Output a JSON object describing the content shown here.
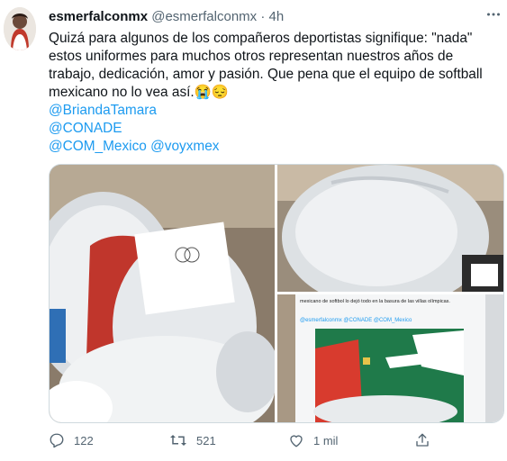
{
  "tweet": {
    "author_name": "esmerfalconmx",
    "author_handle": "@esmerfalconmx",
    "separator": "·",
    "time": "4h",
    "more_icon": "more-dots-icon",
    "text_line": "Quizá para algunos de los compañeros deportistas signifique: \"nada\" estos uniformes para muchos otros representan nuestros años de trabajo, dedicación, amor y pasión. Que pena que el equipo de softball mexicano no lo vea así.😭😔",
    "mentions": [
      "@BriandaTamara",
      "@CONADE",
      "@COM_Mexico",
      "@voyxmex"
    ]
  },
  "embedded_screenshot": {
    "text": "mexicano de softbol lo dejó todo en la basura de las villas olímpicas.",
    "mentions": "@esmerfalconmx @CONADE @COM_Mexico"
  },
  "actions": {
    "reply": {
      "icon": "reply-icon",
      "count": "122"
    },
    "retweet": {
      "icon": "retweet-icon",
      "count": "521"
    },
    "like": {
      "icon": "heart-icon",
      "count": "1 mil"
    },
    "share": {
      "icon": "share-icon"
    }
  },
  "colors": {
    "link": "#1d9bf0",
    "secondary_text": "#536471"
  }
}
